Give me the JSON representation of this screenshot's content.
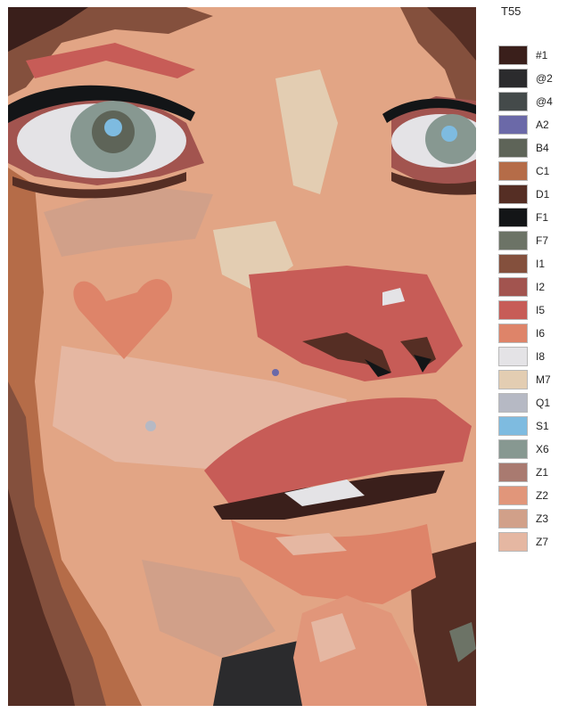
{
  "kit_code": "T55",
  "artwork": {
    "subject": "portrait-face-close-up",
    "skin_base": "#e2a585"
  },
  "palette": [
    {
      "code": "#1",
      "color": "#3a1f1b"
    },
    {
      "code": "@2",
      "color": "#2b2b2d"
    },
    {
      "code": "@4",
      "color": "#444a4a"
    },
    {
      "code": "A2",
      "color": "#6b69a8"
    },
    {
      "code": "B4",
      "color": "#5e6458"
    },
    {
      "code": "C1",
      "color": "#b56c48"
    },
    {
      "code": "D1",
      "color": "#552e24"
    },
    {
      "code": "F1",
      "color": "#131517"
    },
    {
      "code": "F7",
      "color": "#6c7366"
    },
    {
      "code": "I1",
      "color": "#84503d"
    },
    {
      "code": "I2",
      "color": "#a2544f"
    },
    {
      "code": "I5",
      "color": "#c75c57"
    },
    {
      "code": "I6",
      "color": "#de8469"
    },
    {
      "code": "I8",
      "color": "#e4e3e6"
    },
    {
      "code": "M7",
      "color": "#e3cdb2"
    },
    {
      "code": "Q1",
      "color": "#b6b9c4"
    },
    {
      "code": "S1",
      "color": "#7ebbe0"
    },
    {
      "code": "X6",
      "color": "#879891"
    },
    {
      "code": "Z1",
      "color": "#a97a70"
    },
    {
      "code": "Z2",
      "color": "#e1967a"
    },
    {
      "code": "Z3",
      "color": "#d1a089"
    },
    {
      "code": "Z7",
      "color": "#e5b7a2"
    }
  ]
}
